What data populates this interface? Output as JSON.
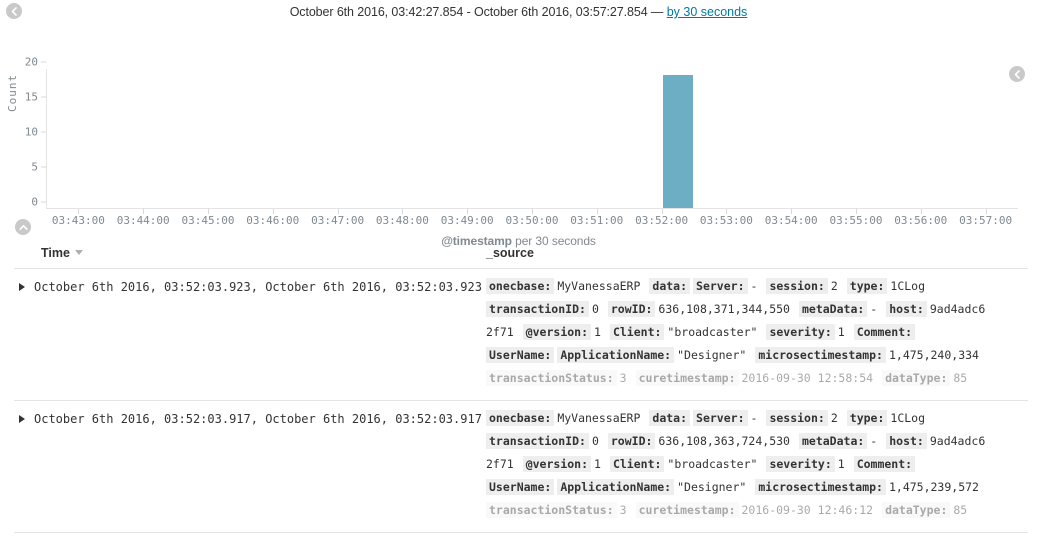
{
  "header": {
    "range_text": "October 6th 2016, 03:42:27.854 - October 6th 2016, 03:57:27.854 — ",
    "interval_link": "by 30 seconds",
    "back_icon": "chevron-left-circle-icon",
    "collapse_right_icon": "chevron-left-circle-icon",
    "collapse_up_icon": "chevron-up-circle-icon"
  },
  "chart_data": {
    "type": "bar",
    "title": "",
    "xlabel": "@timestamp per 30 seconds",
    "ylabel": "Count",
    "ylim": [
      0,
      20
    ],
    "yticks": [
      0,
      5,
      10,
      15,
      20
    ],
    "grid": false,
    "legend": "none",
    "bar_color": "#6eaec4",
    "categories": [
      "03:43:00",
      "03:44:00",
      "03:45:00",
      "03:46:00",
      "03:47:00",
      "03:48:00",
      "03:49:00",
      "03:50:00",
      "03:51:00",
      "03:52:00",
      "03:53:00",
      "03:54:00",
      "03:55:00",
      "03:56:00",
      "03:57:00"
    ],
    "bars": [
      {
        "x_time": "03:52:00",
        "value": 19
      }
    ],
    "axis_note": "bar spans one 30-second bucket starting at 03:52:00"
  },
  "table": {
    "columns": [
      "Time",
      "_source"
    ],
    "sort_icon": "chevron-down-icon",
    "expander_icon": "caret-right-icon",
    "rows": [
      {
        "time": "October 6th 2016, 03:52:03.923, October 6th 2016, 03:52:03.923",
        "source_lines": [
          {
            "faded": false,
            "parts": [
              {
                "type": "field",
                "text": "onecbase:"
              },
              {
                "type": "value",
                "text": "MyVanessaERP"
              },
              {
                "type": "field",
                "text": "data:"
              },
              {
                "type": "field",
                "text": "Server:"
              },
              {
                "type": "value",
                "text": "-"
              },
              {
                "type": "field",
                "text": "session:"
              },
              {
                "type": "value",
                "text": "2"
              },
              {
                "type": "field",
                "text": "type:"
              },
              {
                "type": "value",
                "text": "1CLog"
              }
            ]
          },
          {
            "faded": false,
            "parts": [
              {
                "type": "field",
                "text": "transactionID:"
              },
              {
                "type": "value",
                "text": "0"
              },
              {
                "type": "field",
                "text": "rowID:"
              },
              {
                "type": "value",
                "text": "636,108,371,344,550"
              },
              {
                "type": "field",
                "text": "metaData:"
              },
              {
                "type": "value",
                "text": "-"
              },
              {
                "type": "field",
                "text": "host:"
              },
              {
                "type": "value",
                "text": "9ad4adc6"
              }
            ]
          },
          {
            "faded": false,
            "parts": [
              {
                "type": "value",
                "text": "2f71"
              },
              {
                "type": "field",
                "text": "@version:"
              },
              {
                "type": "value",
                "text": "1"
              },
              {
                "type": "field",
                "text": "Client:"
              },
              {
                "type": "value",
                "text": "\"broadcaster\""
              },
              {
                "type": "field",
                "text": "severity:"
              },
              {
                "type": "value",
                "text": "1"
              },
              {
                "type": "field",
                "text": "Comment:"
              }
            ]
          },
          {
            "faded": false,
            "parts": [
              {
                "type": "field",
                "text": "UserName:"
              },
              {
                "type": "field",
                "text": "ApplicationName:"
              },
              {
                "type": "value",
                "text": "\"Designer\""
              },
              {
                "type": "field",
                "text": "microsectimestamp:"
              },
              {
                "type": "value",
                "text": "1,475,240,334"
              }
            ]
          },
          {
            "faded": true,
            "parts": [
              {
                "type": "field",
                "text": "transactionStatus:"
              },
              {
                "type": "value",
                "text": "3"
              },
              {
                "type": "field",
                "text": "curetimestamp:"
              },
              {
                "type": "value",
                "text": "2016-09-30 12:58:54"
              },
              {
                "type": "field",
                "text": "dataType:"
              },
              {
                "type": "value",
                "text": "85"
              }
            ]
          }
        ]
      },
      {
        "time": "October 6th 2016, 03:52:03.917, October 6th 2016, 03:52:03.917",
        "source_lines": [
          {
            "faded": false,
            "parts": [
              {
                "type": "field",
                "text": "onecbase:"
              },
              {
                "type": "value",
                "text": "MyVanessaERP"
              },
              {
                "type": "field",
                "text": "data:"
              },
              {
                "type": "field",
                "text": "Server:"
              },
              {
                "type": "value",
                "text": "-"
              },
              {
                "type": "field",
                "text": "session:"
              },
              {
                "type": "value",
                "text": "2"
              },
              {
                "type": "field",
                "text": "type:"
              },
              {
                "type": "value",
                "text": "1CLog"
              }
            ]
          },
          {
            "faded": false,
            "parts": [
              {
                "type": "field",
                "text": "transactionID:"
              },
              {
                "type": "value",
                "text": "0"
              },
              {
                "type": "field",
                "text": "rowID:"
              },
              {
                "type": "value",
                "text": "636,108,363,724,530"
              },
              {
                "type": "field",
                "text": "metaData:"
              },
              {
                "type": "value",
                "text": "-"
              },
              {
                "type": "field",
                "text": "host:"
              },
              {
                "type": "value",
                "text": "9ad4adc6"
              }
            ]
          },
          {
            "faded": false,
            "parts": [
              {
                "type": "value",
                "text": "2f71"
              },
              {
                "type": "field",
                "text": "@version:"
              },
              {
                "type": "value",
                "text": "1"
              },
              {
                "type": "field",
                "text": "Client:"
              },
              {
                "type": "value",
                "text": "\"broadcaster\""
              },
              {
                "type": "field",
                "text": "severity:"
              },
              {
                "type": "value",
                "text": "1"
              },
              {
                "type": "field",
                "text": "Comment:"
              }
            ]
          },
          {
            "faded": false,
            "parts": [
              {
                "type": "field",
                "text": "UserName:"
              },
              {
                "type": "field",
                "text": "ApplicationName:"
              },
              {
                "type": "value",
                "text": "\"Designer\""
              },
              {
                "type": "field",
                "text": "microsectimestamp:"
              },
              {
                "type": "value",
                "text": "1,475,239,572"
              }
            ]
          },
          {
            "faded": true,
            "parts": [
              {
                "type": "field",
                "text": "transactionStatus:"
              },
              {
                "type": "value",
                "text": "3"
              },
              {
                "type": "field",
                "text": "curetimestamp:"
              },
              {
                "type": "value",
                "text": "2016-09-30 12:46:12"
              },
              {
                "type": "field",
                "text": "dataType:"
              },
              {
                "type": "value",
                "text": "85"
              }
            ]
          }
        ]
      }
    ]
  }
}
